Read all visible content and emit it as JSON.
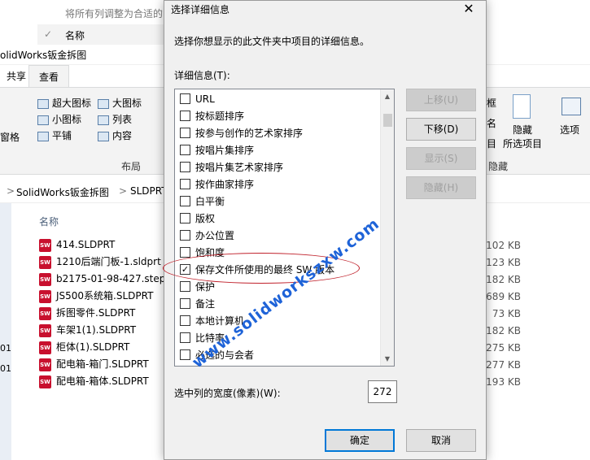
{
  "background": {
    "faded_row_text": "将所有列调整为合适的",
    "name_row_text": "名称",
    "window_title": "olidWorks钣金拆图",
    "tabs": [
      "共享",
      "查看"
    ],
    "ribbon": {
      "layout_items": [
        "超大图标",
        "大图标",
        "小图标",
        "列表",
        "平铺",
        "内容"
      ],
      "layout_group": "布局",
      "pane_label": "窗格",
      "right_items": {
        "frame": "框",
        "name": "名",
        "item": "目",
        "hide": "隐藏",
        "hide_sub": "所选项目",
        "options": "选项",
        "hidden_group": "隐藏"
      }
    },
    "address": {
      "part1": "SolidWorks钣金拆图",
      "sep": ">",
      "part2": "SLDPRT"
    },
    "column_name": "名称",
    "files": [
      {
        "name": "414.SLDPRT",
        "size": "102 KB"
      },
      {
        "name": "1210后端门板-1.sldprt",
        "size": "123 KB"
      },
      {
        "name": "b2175-01-98-427.step.",
        "size": "182 KB"
      },
      {
        "name": "JS500系统箱.SLDPRT",
        "size": "689 KB"
      },
      {
        "name": "拆图零件.SLDPRT",
        "size": "73 KB"
      },
      {
        "name": "车架1(1).SLDPRT",
        "size": "182 KB"
      },
      {
        "name": "柜体(1).SLDPRT",
        "size": "275 KB"
      },
      {
        "name": "配电箱-箱门.SLDPRT",
        "size": "277 KB"
      },
      {
        "name": "配电箱-箱体.SLDPRT",
        "size": "193 KB"
      }
    ],
    "left_fragments": [
      "01",
      "01"
    ]
  },
  "dialog": {
    "title": "选择详细信息",
    "close": "✕",
    "description": "选择你想显示的此文件夹中项目的详细信息。",
    "details_label": "详细信息(T):",
    "items": [
      {
        "label": "URL",
        "checked": false
      },
      {
        "label": "按标题排序",
        "checked": false
      },
      {
        "label": "按参与创作的艺术家排序",
        "checked": false
      },
      {
        "label": "按唱片集排序",
        "checked": false
      },
      {
        "label": "按唱片集艺术家排序",
        "checked": false
      },
      {
        "label": "按作曲家排序",
        "checked": false
      },
      {
        "label": "白平衡",
        "checked": false
      },
      {
        "label": "版权",
        "checked": false
      },
      {
        "label": "办公位置",
        "checked": false
      },
      {
        "label": "饱和度",
        "checked": false
      },
      {
        "label": "保存文件所使用的最终 SW 版本",
        "checked": true
      },
      {
        "label": "保护",
        "checked": false
      },
      {
        "label": "备注",
        "checked": false
      },
      {
        "label": "本地计算机",
        "checked": false
      },
      {
        "label": "比特率",
        "checked": false
      },
      {
        "label": "必选的与会者",
        "checked": false
      }
    ],
    "buttons": {
      "move_up": "上移(U)",
      "move_down": "下移(D)",
      "show": "显示(S)",
      "hide": "隐藏(H)",
      "ok": "确定",
      "cancel": "取消"
    },
    "width_label": "选中列的宽度(像素)(W):",
    "width_value": "272"
  },
  "watermark": "www.solidworkszxw.com",
  "colors": {
    "highlight": "#c0212b",
    "watermark": "#1e63d8",
    "accent": "#0078d7"
  }
}
